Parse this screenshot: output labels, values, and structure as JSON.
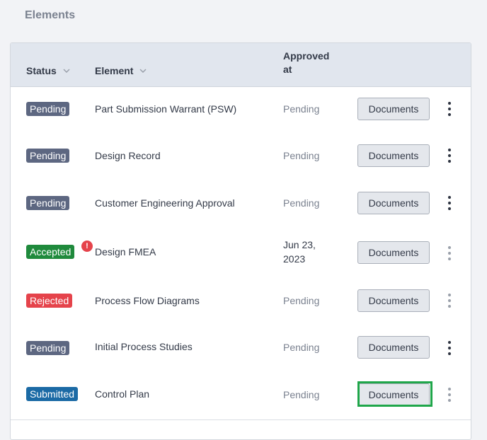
{
  "section": {
    "title": "Elements"
  },
  "table": {
    "columns": {
      "status": "Status",
      "element": "Element",
      "approved_line1": "Approved",
      "approved_line2": "at"
    },
    "rows": [
      {
        "status": "Pending",
        "status_type": "pending",
        "element": "Part Submission Warrant (PSW)",
        "approved_at": "Pending",
        "documents_label": "Documents"
      },
      {
        "status": "Pending",
        "status_type": "pending",
        "element": "Design Record",
        "approved_at": "Pending",
        "documents_label": "Documents"
      },
      {
        "status": "Pending",
        "status_type": "pending",
        "element": "Customer Engineering Approval",
        "approved_at": "Pending",
        "documents_label": "Documents"
      },
      {
        "status": "Accepted",
        "status_type": "accepted",
        "alert": "!",
        "element": "Design FMEA",
        "approved_line1": "Jun 23,",
        "approved_line2": "2023",
        "documents_label": "Documents"
      },
      {
        "status": "Rejected",
        "status_type": "rejected",
        "element": "Process Flow Diagrams",
        "approved_at": "Pending",
        "documents_label": "Documents"
      },
      {
        "status": "Pending",
        "status_type": "pending",
        "element": "Initial Process Studies",
        "approved_at": "Pending",
        "documents_label": "Documents"
      },
      {
        "status": "Submitted",
        "status_type": "submitted",
        "element": "Control Plan",
        "approved_at": "Pending",
        "documents_label": "Documents"
      }
    ]
  },
  "colors": {
    "pending": "#5d6781",
    "accepted": "#1f8a3c",
    "rejected": "#e5434b",
    "submitted": "#1b6aa5",
    "highlight": "#1fa64a"
  },
  "icons": {
    "sort": "chevron-down-icon",
    "more": "kebab-menu-icon",
    "alert": "exclamation-icon"
  }
}
